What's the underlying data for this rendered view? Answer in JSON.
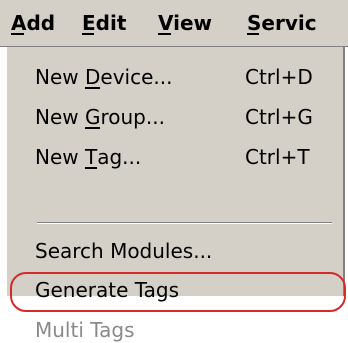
{
  "menubar": {
    "items": [
      {
        "label": "Add",
        "mnemonic": "A"
      },
      {
        "label": "Edit",
        "mnemonic": "E"
      },
      {
        "label": "View",
        "mnemonic": "V"
      },
      {
        "label": "Servic",
        "mnemonic": "S"
      }
    ]
  },
  "dropdown": {
    "items": [
      {
        "prefix": "New ",
        "mnemonic": "D",
        "suffix": "evice...",
        "shortcut": "Ctrl+D"
      },
      {
        "prefix": "New ",
        "mnemonic": "G",
        "suffix": "roup...",
        "shortcut": "Ctrl+G"
      },
      {
        "prefix": "New ",
        "mnemonic": "T",
        "suffix": "ag...",
        "shortcut": "Ctrl+T"
      },
      {
        "label": "Search Modules..."
      },
      {
        "label": "Generate Tags"
      },
      {
        "label": "Multi Tags",
        "disabled": true
      }
    ]
  },
  "annotation": {
    "highlight_color": "#d42a2a",
    "highlighted_item": "Generate Tags"
  }
}
